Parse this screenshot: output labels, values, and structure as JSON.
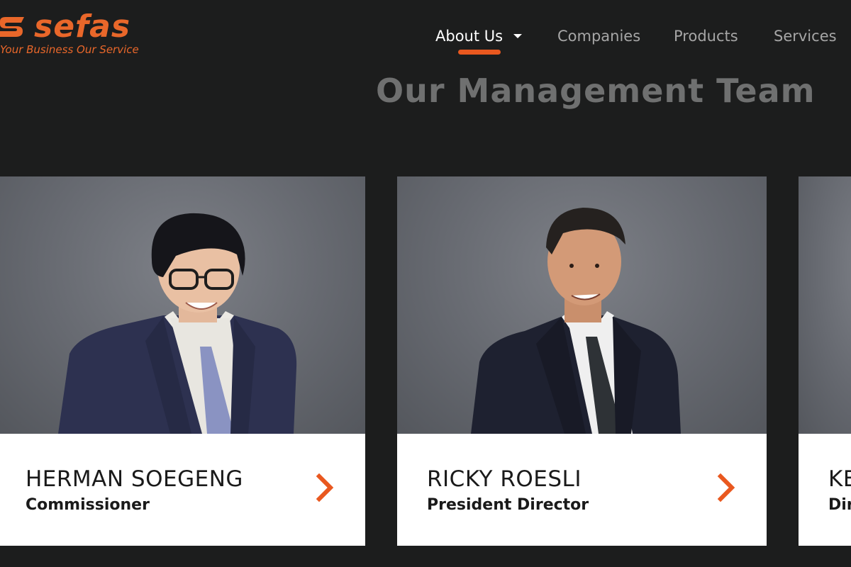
{
  "brand": {
    "name": "sefas",
    "tagline": "Your Business Our Service",
    "color": "#e9672a"
  },
  "nav": {
    "items": [
      {
        "label": "About Us",
        "active": true,
        "has_dropdown": true
      },
      {
        "label": "Companies",
        "active": false
      },
      {
        "label": "Products",
        "active": false
      },
      {
        "label": "Services",
        "active": false
      }
    ],
    "accent": "#e9581f"
  },
  "section": {
    "title": "Our Management Team"
  },
  "team": [
    {
      "name": "HERMAN SOEGENG",
      "role": "Commissioner",
      "icon": "chevron-right-icon"
    },
    {
      "name": "RICKY ROESLI",
      "role": "President Director",
      "icon": "chevron-right-icon"
    },
    {
      "name": "KE",
      "role": "Dir",
      "icon": "chevron-right-icon"
    }
  ]
}
